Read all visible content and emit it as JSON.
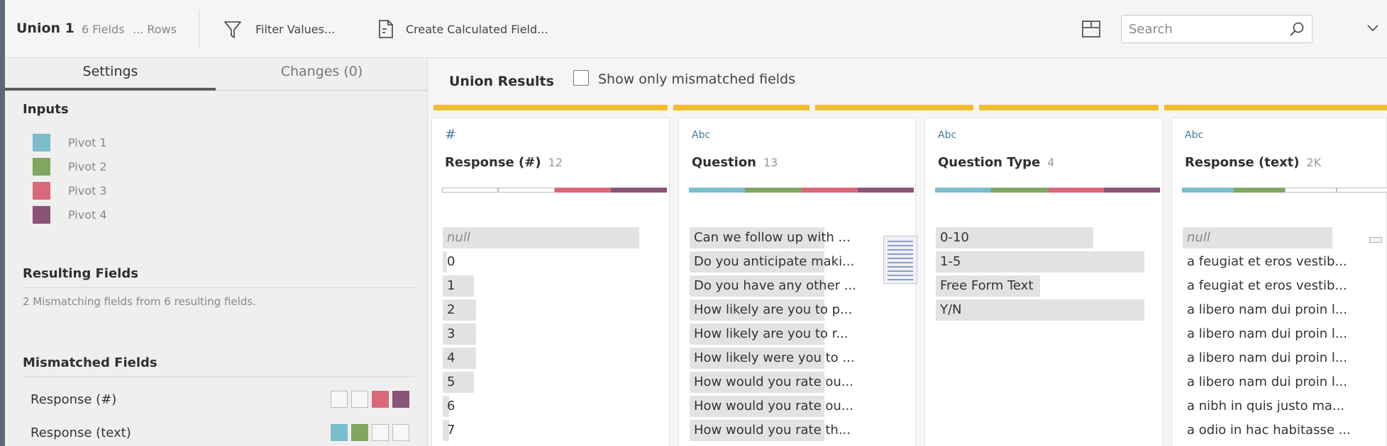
{
  "toolbar": {
    "step_name": "Union 1",
    "fields_count": "6 Fields",
    "rows_count": "... Rows",
    "filter_label": "Filter Values...",
    "calc_label": "Create Calculated Field...",
    "search_placeholder": "Search"
  },
  "left_panel": {
    "tabs": {
      "settings": "Settings",
      "changes": "Changes (0)"
    },
    "inputs_title": "Inputs",
    "inputs": [
      {
        "label": "Pivot 1",
        "color": "#7bbccd"
      },
      {
        "label": "Pivot 2",
        "color": "#7fa75f"
      },
      {
        "label": "Pivot 3",
        "color": "#d9697a"
      },
      {
        "label": "Pivot 4",
        "color": "#8a5479"
      }
    ],
    "resulting_title": "Resulting Fields",
    "resulting_text": "2 Mismatching fields from 6 resulting fields.",
    "mismatched_title": "Mismatched Fields",
    "mismatched": [
      {
        "label": "Response (#)",
        "present": [
          false,
          false,
          true,
          true
        ]
      },
      {
        "label": "Response (text)",
        "present": [
          true,
          true,
          false,
          false
        ]
      }
    ]
  },
  "union_results": {
    "title": "Union Results",
    "mismatch_checkbox_label": "Show only mismatched fields",
    "columns": [
      {
        "type_icon": "#",
        "name": "Response (#)",
        "count": "12",
        "present": [
          false,
          false,
          true,
          true
        ],
        "values": [
          {
            "text": "null",
            "null": true,
            "bar": 0.94
          },
          {
            "text": "0",
            "bar": 0.02
          },
          {
            "text": "1",
            "bar": 0.15
          },
          {
            "text": "2",
            "bar": 0.16
          },
          {
            "text": "3",
            "bar": 0.16
          },
          {
            "text": "4",
            "bar": 0.16
          },
          {
            "text": "5",
            "bar": 0.15
          },
          {
            "text": "6",
            "bar": 0.03
          },
          {
            "text": "7",
            "bar": 0.03
          }
        ]
      },
      {
        "type_icon": "Abc",
        "name": "Question",
        "count": "13",
        "present": [
          true,
          true,
          true,
          true
        ],
        "values": [
          {
            "text": "Can we follow up with ...",
            "bar": 0.78
          },
          {
            "text": "Do you anticipate maki...",
            "bar": 0.78
          },
          {
            "text": "Do you have any other ...",
            "bar": 0.78
          },
          {
            "text": "How likely are you to p...",
            "bar": 0.78
          },
          {
            "text": "How likely are you to r...",
            "bar": 0.78
          },
          {
            "text": "How likely were you to ...",
            "bar": 0.78
          },
          {
            "text": "How would you rate ou...",
            "bar": 0.78
          },
          {
            "text": "How would you rate ou...",
            "bar": 0.78
          },
          {
            "text": "How would you rate th...",
            "bar": 0.78
          }
        ]
      },
      {
        "type_icon": "Abc",
        "name": "Question Type",
        "count": "4",
        "present": [
          true,
          true,
          true,
          true
        ],
        "values": [
          {
            "text": "0-10",
            "bar": 0.71
          },
          {
            "text": "1-5",
            "bar": 0.94
          },
          {
            "text": "Free Form Text",
            "bar": 0.47
          },
          {
            "text": "Y/N",
            "bar": 0.94
          }
        ]
      },
      {
        "type_icon": "Abc",
        "name": "Response (text)",
        "count": "2K",
        "present": [
          true,
          true,
          false,
          false
        ],
        "values": [
          {
            "text": "null",
            "null": true,
            "bar": 0.86
          },
          {
            "text": "a feugiat et eros vestib...",
            "bar": 0
          },
          {
            "text": "a feugiat et eros vestib...",
            "bar": 0
          },
          {
            "text": "a libero nam dui proin l...",
            "bar": 0
          },
          {
            "text": "a libero nam dui proin l...",
            "bar": 0
          },
          {
            "text": "a libero nam dui proin l...",
            "bar": 0
          },
          {
            "text": "a libero nam dui proin l...",
            "bar": 0
          },
          {
            "text": "a nibh in quis justo ma...",
            "bar": 0
          },
          {
            "text": "a odio in hac habitasse ...",
            "bar": 0
          }
        ]
      }
    ]
  }
}
